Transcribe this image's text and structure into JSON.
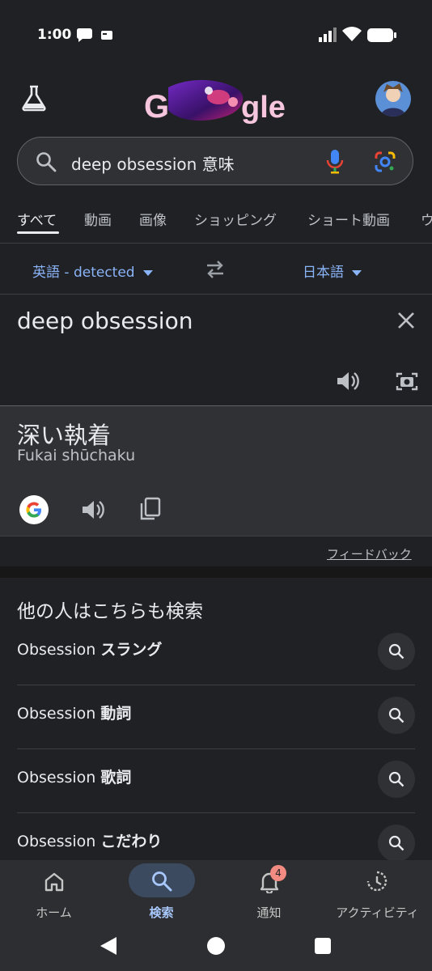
{
  "status_bar": {
    "time": "1:00"
  },
  "search": {
    "query": "deep obsession 意味"
  },
  "tabs": [
    "すべて",
    "動画",
    "画像",
    "ショッピング",
    "ショート動画",
    "ウ"
  ],
  "translate": {
    "source_lang": "英語 - detected",
    "target_lang": "日本語",
    "source_text": "deep obsession",
    "result_text": "深い執着",
    "romanization": "Fukai shūchaku",
    "feedback": "フィードバック"
  },
  "related": {
    "title": "他の人はこちらも検索",
    "items": [
      {
        "prefix": "Obsession",
        "suffix": "スラング"
      },
      {
        "prefix": "Obsession",
        "suffix": "動詞"
      },
      {
        "prefix": "Obsession",
        "suffix": "歌詞"
      },
      {
        "prefix": "Obsession",
        "suffix": "こだわり"
      }
    ]
  },
  "bottom_nav": {
    "home": "ホーム",
    "search": "検索",
    "notifications": "通知",
    "notifications_badge": "4",
    "activity": "アクティビティ"
  },
  "icons": {
    "labs": "flask-icon",
    "search": "search-icon",
    "mic": "mic-icon",
    "lens": "lens-icon",
    "swap": "swap-icon",
    "clear": "close-icon",
    "speaker": "speaker-icon",
    "camera": "camera-icon",
    "copy": "copy-icon",
    "google": "google-g-icon"
  },
  "colors": {
    "accent": "#8ab4f8",
    "background": "#202124",
    "badge": "#f28b82"
  }
}
